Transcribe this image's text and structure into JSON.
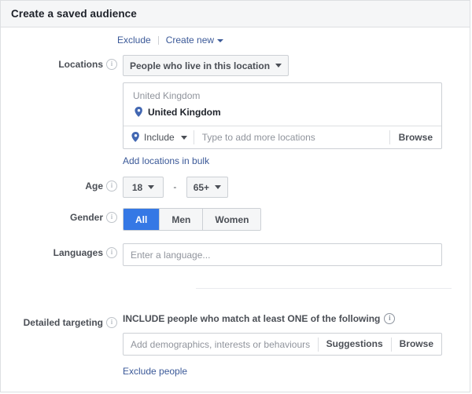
{
  "window": {
    "title": "Create a saved audience"
  },
  "top_links": {
    "exclude_label": "Exclude",
    "create_new_label": "Create new",
    "caret_icon": "chevron-down-icon"
  },
  "locations": {
    "label": "Locations",
    "info_icon": "info-icon",
    "mode_select": {
      "value": "People who live in this location",
      "caret_icon": "chevron-down-icon"
    },
    "group_header": "United Kingdom",
    "selected": [
      {
        "name": "United Kingdom",
        "pin_icon": "map-pin-icon"
      }
    ],
    "include_control": {
      "label": "Include",
      "pin_icon": "map-pin-icon",
      "caret_icon": "chevron-down-icon"
    },
    "search_placeholder": "Type to add more locations",
    "search_value": "",
    "browse_label": "Browse",
    "bulk_link": "Add locations in bulk"
  },
  "age": {
    "label": "Age",
    "info_icon": "info-icon",
    "min": "18",
    "max": "65+",
    "separator": "-",
    "caret_icon": "chevron-down-icon"
  },
  "gender": {
    "label": "Gender",
    "info_icon": "info-icon",
    "options": [
      {
        "label": "All",
        "selected": true
      },
      {
        "label": "Men",
        "selected": false
      },
      {
        "label": "Women",
        "selected": false
      }
    ]
  },
  "languages": {
    "label": "Languages",
    "info_icon": "info-icon",
    "placeholder": "Enter a language...",
    "value": ""
  },
  "detailed_targeting": {
    "label": "Detailed targeting",
    "info_icon": "info-icon",
    "heading": "INCLUDE people who match at least ONE of the following",
    "heading_info_icon": "info-icon",
    "placeholder": "Add demographics, interests or behaviours",
    "value": "",
    "suggestions_label": "Suggestions",
    "browse_label": "Browse",
    "exclude_link": "Exclude people"
  },
  "colors": {
    "accent_blue": "#3578e5",
    "link_blue": "#3b5998",
    "header_bg": "#f5f6f7",
    "border": "#ccd0d5",
    "muted_text": "#90949c",
    "label_text": "#4b4f56"
  }
}
